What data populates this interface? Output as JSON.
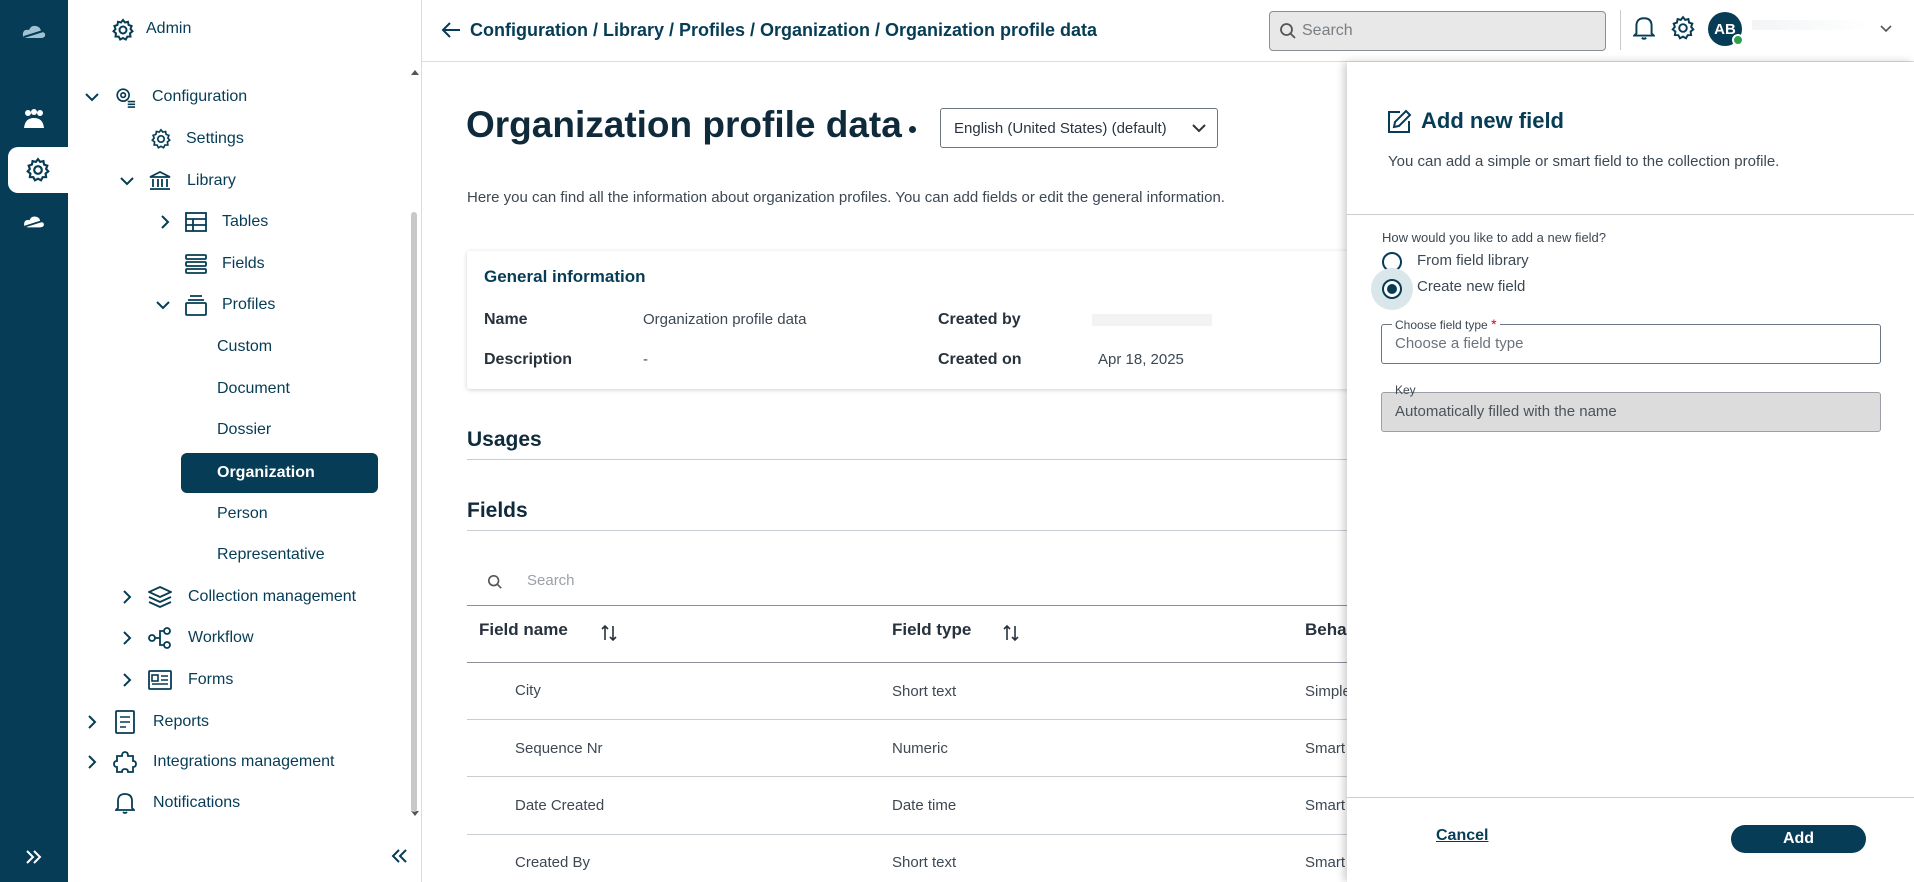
{
  "header": {
    "breadcrumb": "Configuration / Library / Profiles / Organization / Organization profile data",
    "search_placeholder": "Search",
    "avatar_initials": "AB"
  },
  "sidebar": {
    "title": "Admin",
    "items": [
      {
        "label": "Configuration"
      },
      {
        "label": "Settings"
      },
      {
        "label": "Library"
      },
      {
        "label": "Tables"
      },
      {
        "label": "Fields"
      },
      {
        "label": "Profiles"
      },
      {
        "label": "Custom"
      },
      {
        "label": "Document"
      },
      {
        "label": "Dossier"
      },
      {
        "label": "Organization"
      },
      {
        "label": "Person"
      },
      {
        "label": "Representative"
      },
      {
        "label": "Collection management"
      },
      {
        "label": "Workflow"
      },
      {
        "label": "Forms"
      },
      {
        "label": "Reports"
      },
      {
        "label": "Integrations management"
      },
      {
        "label": "Notifications"
      }
    ]
  },
  "main": {
    "title": "Organization profile data",
    "language": "English (United States) (default)",
    "intro": "Here you can find all the information about organization profiles. You can add fields or edit the general information.",
    "general": {
      "heading": "General information",
      "name_label": "Name",
      "name_value": "Organization profile data",
      "description_label": "Description",
      "description_value": "-",
      "created_by_label": "Created by",
      "created_on_label": "Created on",
      "created_on_value": "Apr 18, 2025"
    },
    "usages_heading": "Usages",
    "fields_heading": "Fields",
    "table": {
      "search_placeholder": "Search",
      "columns": [
        "Field name",
        "Field type",
        "Beha"
      ],
      "rows": [
        [
          "City",
          "Short text",
          "Simple"
        ],
        [
          "Sequence Nr",
          "Numeric",
          "Smart"
        ],
        [
          "Date Created",
          "Date time",
          "Smart"
        ],
        [
          "Created By",
          "Short text",
          "Smart"
        ]
      ]
    }
  },
  "drawer": {
    "title": "Add new field",
    "subtitle": "You can add a simple or smart field to the collection profile.",
    "question": "How would you like to add a new field?",
    "option_library": "From field library",
    "option_create": "Create new field",
    "field_type_label": "Choose field type",
    "required_mark": "*",
    "field_type_placeholder": "Choose a field type",
    "key_label": "Key",
    "key_value": "Automatically filled with the name",
    "cancel": "Cancel",
    "add": "Add"
  },
  "colors": {
    "primary": "#063c55",
    "required": "#d0021b",
    "online": "#2e9e4f"
  }
}
